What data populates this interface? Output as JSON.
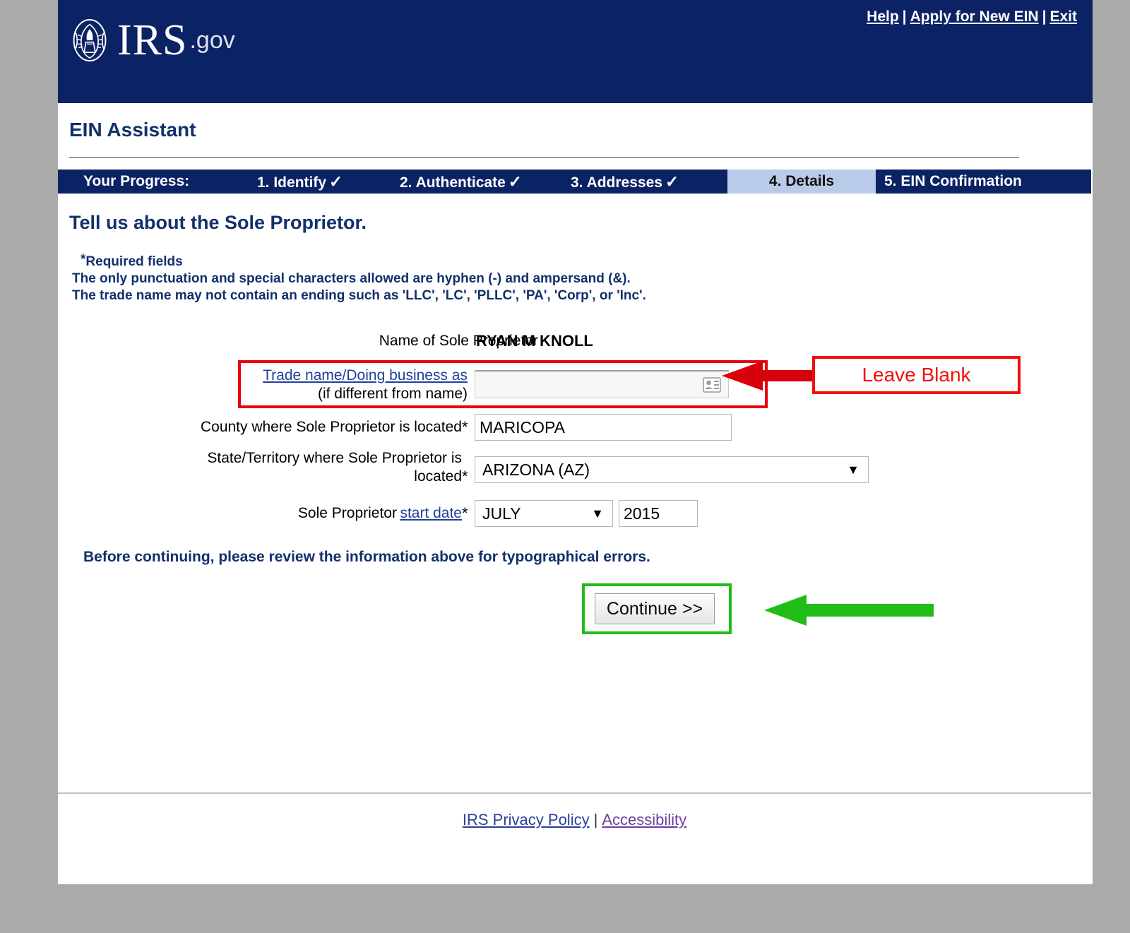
{
  "header": {
    "brand_main": "IRS",
    "brand_suffix": ".gov",
    "seal_icon": "irs-eagle-seal-icon",
    "links": [
      {
        "label": "Help"
      },
      {
        "label": "Apply for New EIN"
      },
      {
        "label": "Exit"
      }
    ],
    "separator": "|"
  },
  "app": {
    "title": "EIN Assistant"
  },
  "progress": {
    "label": "Your Progress:",
    "check_glyph": "✓",
    "steps": [
      {
        "label": "1. Identify",
        "complete": true
      },
      {
        "label": "2. Authenticate",
        "complete": true
      },
      {
        "label": "3. Addresses",
        "complete": true
      },
      {
        "label": "4. Details",
        "complete": false,
        "current": true
      },
      {
        "label": "5. EIN Confirmation",
        "complete": false
      }
    ]
  },
  "main": {
    "heading": "Tell us about the Sole Proprietor.",
    "notes": {
      "required_star": "*",
      "required_text": "Required fields",
      "line2": "The only punctuation and special characters allowed are hyphen (-) and ampersand (&).",
      "line3": "The trade name may not contain an ending such as 'LLC', 'LC', 'PLLC', 'PA', 'Corp', or 'Inc'."
    },
    "fields": {
      "name": {
        "label": "Name of Sole Proprietor",
        "value": "RYAN M KNOLL"
      },
      "trade_name": {
        "link_label": "Trade name/Doing business as",
        "sub_label": "(if different from name)",
        "value": "",
        "autofill_icon": "contact-card-icon"
      },
      "county": {
        "label": "County where Sole Proprietor is located",
        "required_star": "*",
        "value": "MARICOPA"
      },
      "state": {
        "label_line1": "State/Territory where Sole Proprietor is",
        "label_line2": "located",
        "required_star": "*",
        "value": "ARIZONA (AZ)",
        "caret_glyph": "▼"
      },
      "start_date": {
        "label_prefix": "Sole Proprietor",
        "link_label": "start date",
        "required_star": "*",
        "month_value": "JULY",
        "year_value": "2015",
        "caret_glyph": "▼"
      }
    },
    "review_note": "Before continuing, please review the information above for typographical errors.",
    "continue_label": "Continue >>"
  },
  "annotations": {
    "leave_blank_text": "Leave Blank",
    "red_color": "#f20d0d",
    "green_color": "#1fbd16"
  },
  "footer": {
    "privacy_label": "IRS Privacy Policy",
    "separator": "|",
    "accessibility_label": "Accessibility"
  }
}
